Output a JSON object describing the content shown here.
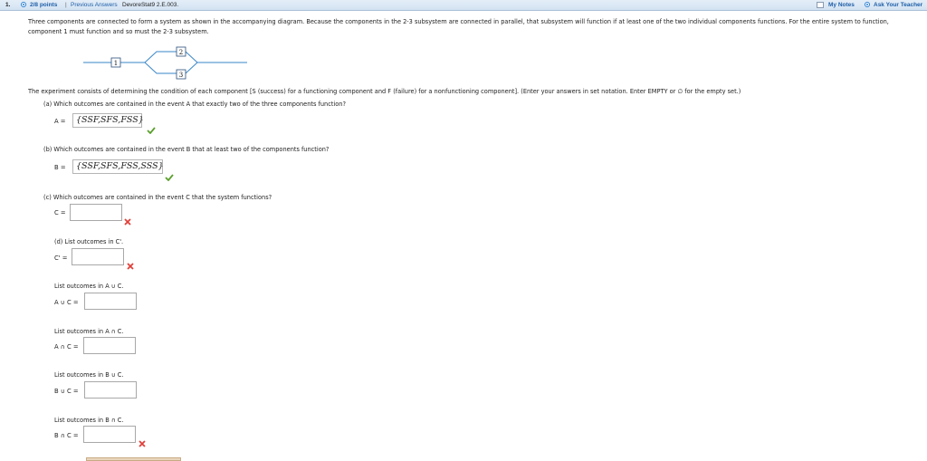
{
  "header": {
    "question_number": "1.",
    "points": "2/8 points",
    "separator": "|",
    "previous_answers": "Previous Answers",
    "source_id": "DevoreStat9 2.E.003.",
    "my_notes": "My Notes",
    "ask_teacher": "Ask Your Teacher"
  },
  "intro_text": "Three components are connected to form a system as shown in the accompanying diagram. Because the components in the 2-3 subsystem are connected in parallel, that subsystem will function if at least one of the two individual components functions. For the entire system to function, component 1 must function and so must the 2-3 subsystem.",
  "diagram": {
    "labels": [
      "1",
      "2",
      "3"
    ]
  },
  "experiment_text": "The experiment consists of determining the condition of each component [S (success) for a functioning component and F (failure) for a nonfunctioning component]. (Enter your answers in set notation. Enter EMPTY or ∅ for the empty set.)",
  "parts": {
    "a": {
      "question": "(a) Which outcomes are contained in the event A that exactly two of the three components function?",
      "label": "A =",
      "answer": "{SSF,SFS,FSS}",
      "status": "correct"
    },
    "b": {
      "question": "(b) Which outcomes are contained in the event B that at least two of the components function?",
      "label": "B =",
      "answer": "{SSF,SFS,FSS,SSS}",
      "status": "correct"
    },
    "c": {
      "question": "(c) Which outcomes are contained in the event C that the system functions?",
      "label": "C =",
      "answer": "",
      "status": "incorrect"
    },
    "d": {
      "question": "(d) List outcomes in C'.",
      "label": "C' =",
      "answer": "",
      "status": "incorrect"
    },
    "aunionc": {
      "question": "List outcomes in A ∪ C.",
      "label": "A ∪ C =",
      "answer": ""
    },
    "aintc": {
      "question": "List outcomes in A ∩ C.",
      "label": "A ∩ C =",
      "answer": ""
    },
    "bunionc": {
      "question": "List outcomes in B ∪ C.",
      "label": "B ∪ C =",
      "answer": ""
    },
    "bintc": {
      "question": "List outcomes in B ∩ C.",
      "label": "B ∩ C =",
      "answer": "",
      "status": "incorrect"
    }
  },
  "colors": {
    "correct": "#5aa02c",
    "incorrect": "#e0403a",
    "link": "#1f5fa8",
    "diagram": "#3a86c8"
  }
}
